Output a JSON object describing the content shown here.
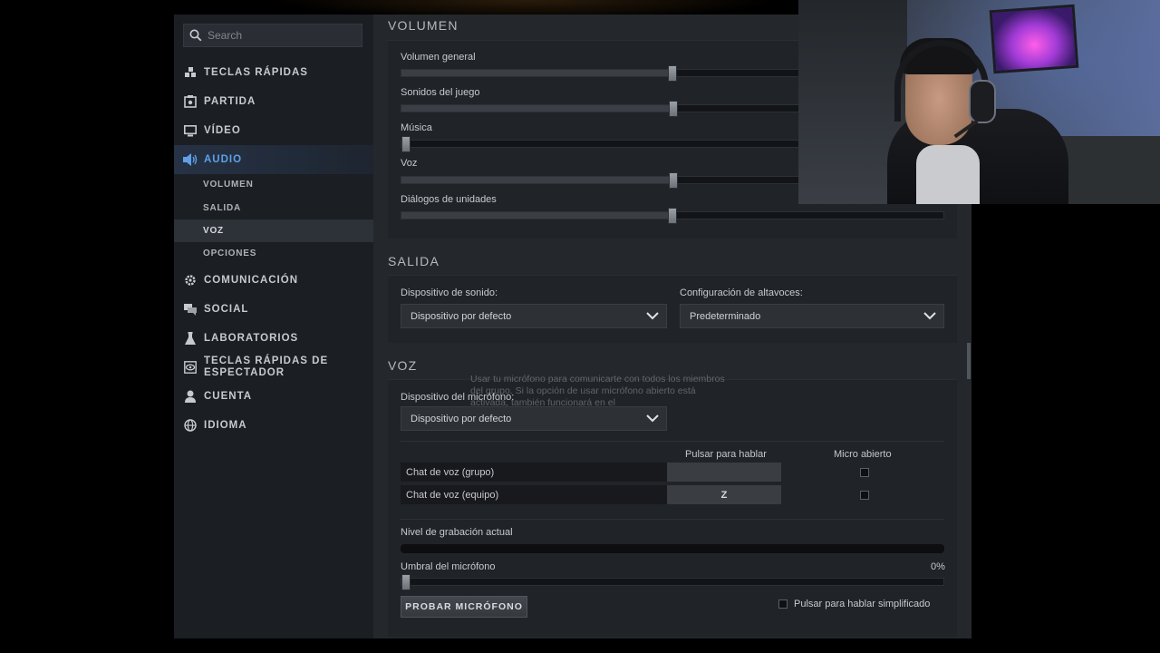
{
  "search": {
    "placeholder": "Search"
  },
  "sidebar": {
    "items": [
      {
        "label": "TECLAS RÁPIDAS",
        "icon": "grid-icon"
      },
      {
        "label": "PARTIDA",
        "icon": "gamepad-icon"
      },
      {
        "label": "VÍDEO",
        "icon": "monitor-icon"
      },
      {
        "label": "AUDIO",
        "icon": "speaker-icon",
        "active": true
      },
      {
        "label": "COMUNICACIÓN",
        "icon": "gear-icon"
      },
      {
        "label": "SOCIAL",
        "icon": "chat-icon"
      },
      {
        "label": "LABORATORIOS",
        "icon": "flask-icon"
      },
      {
        "label": "TECLAS RÁPIDAS DE ESPECTADOR",
        "icon": "eye-icon"
      },
      {
        "label": "CUENTA",
        "icon": "user-icon"
      },
      {
        "label": "IDIOMA",
        "icon": "globe-icon"
      }
    ],
    "audio_sub": [
      {
        "label": "VOLUMEN"
      },
      {
        "label": "SALIDA"
      },
      {
        "label": "VOZ",
        "active": true
      },
      {
        "label": "OPCIONES"
      }
    ]
  },
  "volumen": {
    "title": "VOLUMEN",
    "sliders": [
      {
        "label": "Volumen general",
        "value": 0.5
      },
      {
        "label": "Sonidos del juego",
        "value": 0.502
      },
      {
        "label": "Música",
        "value": 0.0
      },
      {
        "label": "Voz",
        "value": 0.502
      },
      {
        "label": "Diálogos de unidades",
        "value": 0.5
      }
    ]
  },
  "salida": {
    "title": "SALIDA",
    "device_label": "Dispositivo de sonido:",
    "device_value": "Dispositivo por defecto",
    "speakers_label": "Configuración de altavoces:",
    "speakers_value": "Predeterminado"
  },
  "voz": {
    "title": "VOZ",
    "tooltip": "Usar tu micrófono para comunicarte con todos los miembros del grupo. Si la opción de usar micrófono abierto está activada, también funcionará en el",
    "mic_label": "Dispositivo del micrófono:",
    "mic_value": "Dispositivo por defecto",
    "col_ptt": "Pulsar para hablar",
    "col_open": "Micro abierto",
    "rows": [
      {
        "label": "Chat de voz (grupo)",
        "key": "",
        "open_mic": false
      },
      {
        "label": "Chat de voz (equipo)",
        "key": "Z",
        "open_mic": false
      }
    ],
    "level_label": "Nivel de grabación actual",
    "level_value": 0,
    "threshold_label": "Umbral del micrófono",
    "threshold_value": 0,
    "threshold_text": "0%",
    "test_button": "PROBAR MICRÓFONO",
    "simplified_label": "Pulsar para hablar simplificado",
    "simplified_checked": false
  },
  "colors": {
    "accent": "#5fa0e8",
    "panel": "#24272c",
    "sidebar": "#1b1e23"
  }
}
